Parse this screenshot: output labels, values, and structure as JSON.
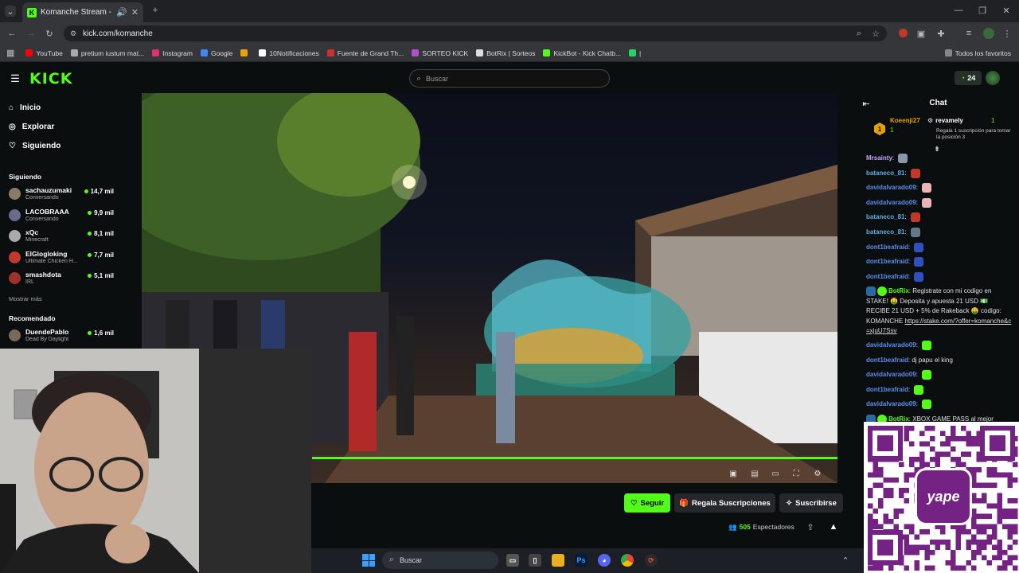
{
  "browser": {
    "tab_title": "Komanche Stream - Watch",
    "url": "kick.com/komanche",
    "bookmarks": [
      {
        "label": "YouTube",
        "color": "#ff0000"
      },
      {
        "label": "pretium iustum mat...",
        "color": "#aaaaaa"
      },
      {
        "label": "Instagram",
        "color": "#e1306c"
      },
      {
        "label": "Google",
        "color": "#4285f4"
      },
      {
        "label": "",
        "color": "#e8a100"
      },
      {
        "label": "10Notificaciones",
        "color": "#ffffff"
      },
      {
        "label": "Fuente de Grand Th...",
        "color": "#d32f2f"
      },
      {
        "label": "SORTEO KICK",
        "color": "#b04fc6"
      },
      {
        "label": "BotRix | Sorteos",
        "color": "#dddddd"
      },
      {
        "label": "KickBot - Kick Chatb...",
        "color": "#53fc18"
      },
      {
        "label": "|",
        "color": "#25d366"
      }
    ],
    "all_bookmarks": "Todos los favoritos"
  },
  "kick": {
    "logo": "KICK",
    "search_placeholder": "Buscar",
    "points": "24"
  },
  "sidebar": {
    "nav": [
      {
        "label": "Inicio",
        "icon": "home-icon"
      },
      {
        "label": "Explorar",
        "icon": "compass-icon"
      },
      {
        "label": "Siguiendo",
        "icon": "heart-icon"
      }
    ],
    "following_title": "Siguiendo",
    "following": [
      {
        "name": "sachauzumaki",
        "category": "Conversando",
        "viewers": "14,7 mil",
        "color": "#8a7a6a"
      },
      {
        "name": "LACOBRAAA",
        "category": "Conversando",
        "viewers": "9,9 mil",
        "color": "#6a6a8a"
      },
      {
        "name": "xQc",
        "category": "Minecraft",
        "viewers": "8,1 mil",
        "color": "#aaaaaa"
      },
      {
        "name": "ElGlogloking",
        "category": "Ultimate Chicken H...",
        "viewers": "7,7 mil",
        "color": "#c0392b"
      },
      {
        "name": "smashdota",
        "category": "IRL",
        "viewers": "5,1 mil",
        "color": "#a0302a"
      }
    ],
    "show_more": "Mostrar más",
    "recommended_title": "Recomendado",
    "recommended": [
      {
        "name": "DuendePablo",
        "category": "Dead By Daylight",
        "viewers": "1,6 mil",
        "color": "#7a6a5a"
      }
    ]
  },
  "stream": {
    "follow_label": "Seguir",
    "gift_label": "Regala Suscripciones",
    "subscribe_label": "Suscribirse",
    "viewers_count": "505",
    "viewers_label": "Espectadores",
    "progress_fraction": 1.0
  },
  "chat": {
    "title": "Chat",
    "pinned": [
      {
        "rank": "1",
        "name": "Koeenji27",
        "count": "1"
      },
      {
        "name": "revamely",
        "count": "1",
        "note": "Regala 1 suscripción para tomar la posición 3"
      }
    ],
    "messages": [
      {
        "user": "Mrsainty",
        "color": "#c9a3ff",
        "text": "",
        "emote": "#8899aa"
      },
      {
        "user": "bataneco_81",
        "color": "#5dade2",
        "text": "",
        "emote": "#c0392b"
      },
      {
        "user": "davidalvarado09",
        "color": "#5b8def",
        "text": "",
        "emote": "#e8b4b8"
      },
      {
        "user": "davidalvarado09",
        "color": "#5b8def",
        "text": "",
        "emote": "#e8b4b8"
      },
      {
        "user": "bataneco_81",
        "color": "#5dade2",
        "text": "",
        "emote": "#c0392b"
      },
      {
        "user": "bataneco_81",
        "color": "#5dade2",
        "text": "",
        "emote": "#667788"
      },
      {
        "user": "dont1beafraid",
        "color": "#5b8def",
        "text": "",
        "emote": "#3050c0"
      },
      {
        "user": "dont1beafraid",
        "color": "#5b8def",
        "text": "",
        "emote": "#3050c0"
      },
      {
        "user": "dont1beafraid",
        "color": "#5b8def",
        "text": "",
        "emote": "#3050c0"
      }
    ],
    "bot_message": {
      "user": "BotRix",
      "color": "#53fc18",
      "text": "Registrate con mi codigo en STAKE! 🤑 Deposita y apuesta 21 USD 💵 RECIBE 21 USD + 5% de Rakeback 🤑 codigo: KOMANCHE",
      "link": "https://stake.com/?offer=komanche&c=xjuU7Ssv"
    },
    "messages2": [
      {
        "user": "davidalvarado09",
        "color": "#5b8def",
        "text": "",
        "emote": "#53fc18"
      },
      {
        "user": "dont1beafraid",
        "color": "#5b8def",
        "text": "dj papu el king",
        "emote": ""
      },
      {
        "user": "davidalvarado09",
        "color": "#5b8def",
        "text": "",
        "emote": "#53fc18"
      },
      {
        "user": "dont1beafraid",
        "color": "#5b8def",
        "text": "",
        "emote": "#53fc18"
      },
      {
        "user": "davidalvarado09",
        "color": "#5b8def",
        "text": "",
        "emote": "#53fc18"
      }
    ],
    "bot_message2": {
      "user": "BotRix",
      "color": "#53fc18",
      "text": "XBOX GAME PASS al mejor"
    }
  },
  "qr": {
    "brand": "yape"
  },
  "taskbar": {
    "search_placeholder": "Buscar"
  }
}
